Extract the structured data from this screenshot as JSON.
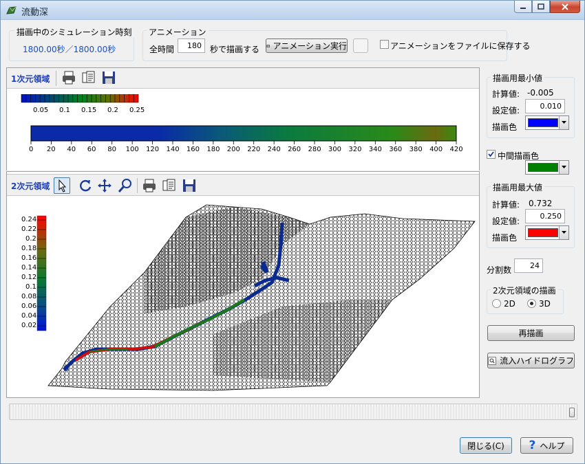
{
  "window": {
    "title": "流動深"
  },
  "sim_time": {
    "group_label": "描画中のシミュレーション時刻",
    "value": "1800.00秒／1800.00秒"
  },
  "animation": {
    "group_label": "アニメーション",
    "total_time_label": "全時間",
    "duration_value": "180",
    "duration_suffix": "秒で描画する",
    "run_button": "アニメーション実行",
    "save_checkbox_label": "アニメーションをファイルに保存する",
    "save_checked": false
  },
  "panel_1d": {
    "label": "1次元領域",
    "small_legend": {
      "ticks": [
        "0.05",
        "0.1",
        "0.15",
        "0.2",
        "0.25"
      ]
    },
    "bar_axis": {
      "ticks": [
        "0",
        "20",
        "40",
        "60",
        "80",
        "100",
        "120",
        "140",
        "160",
        "180",
        "200",
        "220",
        "240",
        "260",
        "280",
        "300",
        "320",
        "340",
        "360",
        "380",
        "400",
        "420"
      ]
    }
  },
  "panel_2d": {
    "label": "2次元領域",
    "legend_ticks": [
      "0.24",
      "0.22",
      "0.2",
      "0.18",
      "0.16",
      "0.14",
      "0.12",
      "0.1",
      "0.08",
      "0.06",
      "0.04",
      "0.02"
    ]
  },
  "right": {
    "min_group": {
      "label": "描画用最小値",
      "calc_label": "計算値:",
      "calc_value": "-0.005",
      "set_label": "設定値:",
      "set_value": "0.010",
      "color_label": "描画色",
      "color": "#0000ff"
    },
    "mid": {
      "checkbox_label": "中間描画色",
      "checked": true,
      "color": "#008000"
    },
    "max_group": {
      "label": "描画用最大値",
      "calc_label": "計算値:",
      "calc_value": "0.732",
      "set_label": "設定値:",
      "set_value": "0.250",
      "color_label": "描画色",
      "color": "#ff0000"
    },
    "divisions_label": "分割数",
    "divisions_value": "24",
    "draw2d_group": {
      "label": "2次元領域の描画",
      "opt_2d": "2D",
      "opt_3d": "3D",
      "selected": "3D"
    },
    "redraw_button": "再描画",
    "hydrograph_button": "流入ハイドログラフ"
  },
  "footer": {
    "close_button": "閉じる(C)",
    "help_button": "ヘルプ"
  }
}
